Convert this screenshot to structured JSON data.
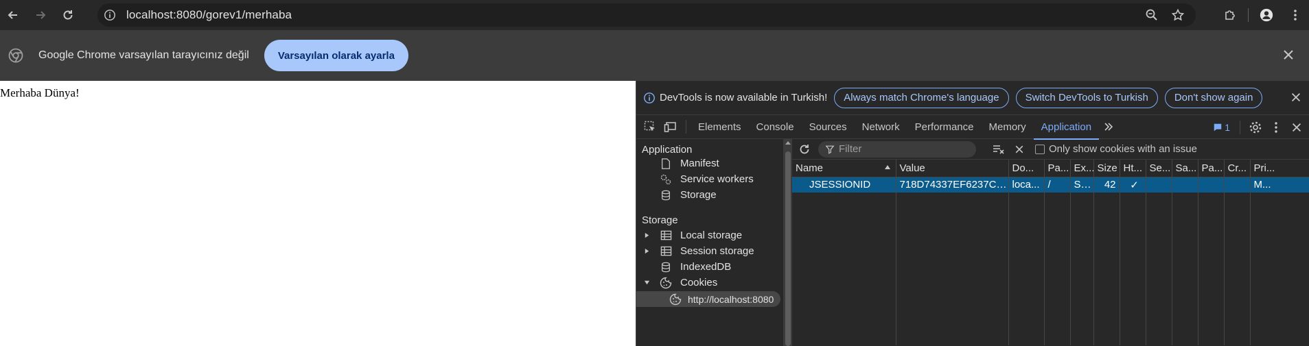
{
  "browser": {
    "url": "localhost:8080/gorev1/merhaba"
  },
  "infobar": {
    "message": "Google Chrome varsayılan tarayıcınız değil",
    "button_label": "Varsayılan olarak ayarla"
  },
  "page": {
    "text": "Merhaba Dünya!"
  },
  "devtools": {
    "lang_bar": {
      "message": "DevTools is now available in Turkish!",
      "always_match": "Always match Chrome's language",
      "switch": "Switch DevTools to Turkish",
      "dont_show": "Don't show again"
    },
    "tabs": [
      "Elements",
      "Console",
      "Sources",
      "Network",
      "Performance",
      "Memory",
      "Application"
    ],
    "active_tab": "Application",
    "issues_count": "1",
    "sidebar": {
      "application_header": "Application",
      "application_items": [
        "Manifest",
        "Service workers",
        "Storage"
      ],
      "storage_header": "Storage",
      "storage_items": [
        "Local storage",
        "Session storage",
        "IndexedDB",
        "Cookies"
      ],
      "cookie_origin": "http://localhost:8080"
    },
    "cookies": {
      "filter_placeholder": "Filter",
      "only_issues_label": "Only show cookies with an issue",
      "columns": [
        "Name",
        "Value",
        "Do...",
        "Pa...",
        "Ex...",
        "Size",
        "Ht...",
        "Se...",
        "Sa...",
        "Pa...",
        "Cr...",
        "Pri..."
      ],
      "rows": [
        [
          "JSESSIONID",
          "718D74337EF6237C9...",
          "loca...",
          "/",
          "Se...",
          "42",
          "✓",
          "",
          "",
          "",
          "",
          "M..."
        ]
      ]
    }
  }
}
